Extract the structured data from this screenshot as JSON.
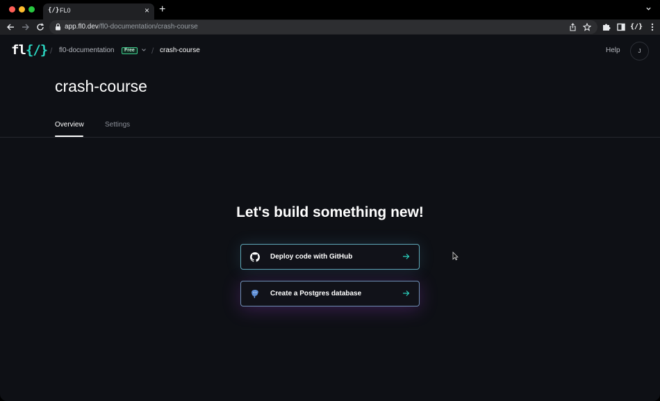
{
  "browser": {
    "tab_title": "FL0",
    "tab_favicon": "{/}",
    "new_tab_label": "+",
    "tab_close_label": "×",
    "url_host": "app.fl0.dev",
    "url_path": "/fl0-documentation/crash-course",
    "ext_label": "{/}"
  },
  "header": {
    "logo_text": "fl",
    "logo_bracket": "{/}",
    "separator": "/",
    "project": "fl0-documentation",
    "plan_badge": "Free",
    "current": "crash-course",
    "help": "Help",
    "avatar_initial": "J"
  },
  "page": {
    "title": "crash-course",
    "tabs": [
      {
        "label": "Overview"
      },
      {
        "label": "Settings"
      }
    ]
  },
  "main": {
    "hero_title": "Let's build something new!",
    "actions": [
      {
        "label": "Deploy code with GitHub",
        "icon": "github-icon"
      },
      {
        "label": "Create a Postgres database",
        "icon": "postgres-icon"
      }
    ]
  },
  "colors": {
    "accent": "#2bd4c0",
    "badge_green": "#3ecf8e",
    "background": "#0e1015"
  }
}
